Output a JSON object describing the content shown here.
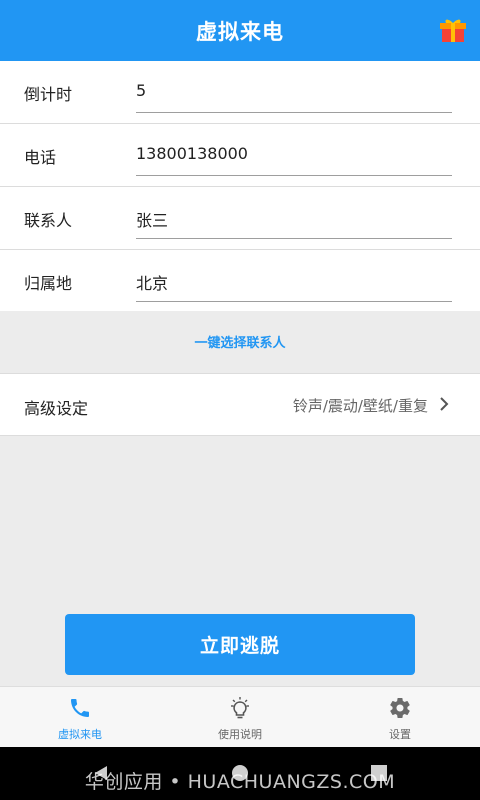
{
  "header": {
    "title": "虚拟来电",
    "gift_icon": "gift-icon"
  },
  "form": {
    "rows": [
      {
        "label": "倒计时",
        "value": "5"
      },
      {
        "label": "电话",
        "value": "13800138000"
      },
      {
        "label": "联系人",
        "value": "张三"
      },
      {
        "label": "归属地",
        "value": "北京"
      }
    ],
    "pick_contact_label": "一键选择联系人"
  },
  "advanced": {
    "label": "高级设定",
    "summary": "铃声/震动/壁纸/重复"
  },
  "primary_button": {
    "label": "立即逃脱"
  },
  "tabs": [
    {
      "label": "虚拟来电",
      "icon": "phone-icon",
      "active": true
    },
    {
      "label": "使用说明",
      "icon": "lightbulb-icon",
      "active": false
    },
    {
      "label": "设置",
      "icon": "gear-icon",
      "active": false
    }
  ],
  "watermark": "华创应用 • HUACHUANGZS.COM",
  "colors": {
    "primary": "#2196f3",
    "background": "#ececec"
  }
}
